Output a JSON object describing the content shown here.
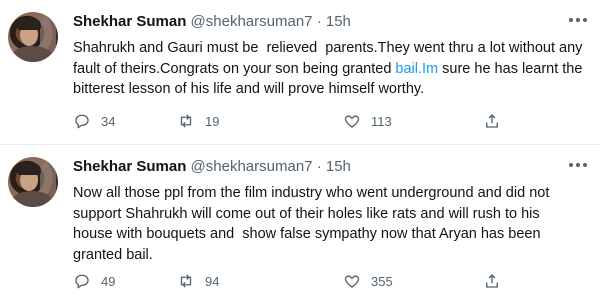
{
  "tweets": [
    {
      "author_name": "Shekhar Suman",
      "handle": "@shekharsuman7",
      "separator": "·",
      "time": "15h",
      "text_before_link": "Shahrukh and Gauri must be  relieved  parents.They went thru a lot without any fault of theirs.Congrats on your son being granted ",
      "link_text": "bail.Im",
      "text_after_link": " sure he has learnt the bitterest lesson of his life and will prove himself worthy.",
      "replies": "34",
      "retweets": "19",
      "likes": "113"
    },
    {
      "author_name": "Shekhar Suman",
      "handle": "@shekharsuman7",
      "separator": "·",
      "time": "15h",
      "text": "Now all those ppl from the film industry who went underground and did not support Shahrukh will come out of their holes like rats and will rush to his house with bouquets and  show false sympathy now that Aryan has been granted bail.",
      "replies": "49",
      "retweets": "94",
      "likes": "355"
    }
  ],
  "icons": {
    "reply": "reply-icon",
    "retweet": "retweet-icon",
    "like": "like-icon",
    "share": "share-icon",
    "more": "more-options-icon"
  },
  "colors": {
    "link": "#1d9bf0",
    "secondary_text": "#536471",
    "divider": "#e6ecf0"
  }
}
